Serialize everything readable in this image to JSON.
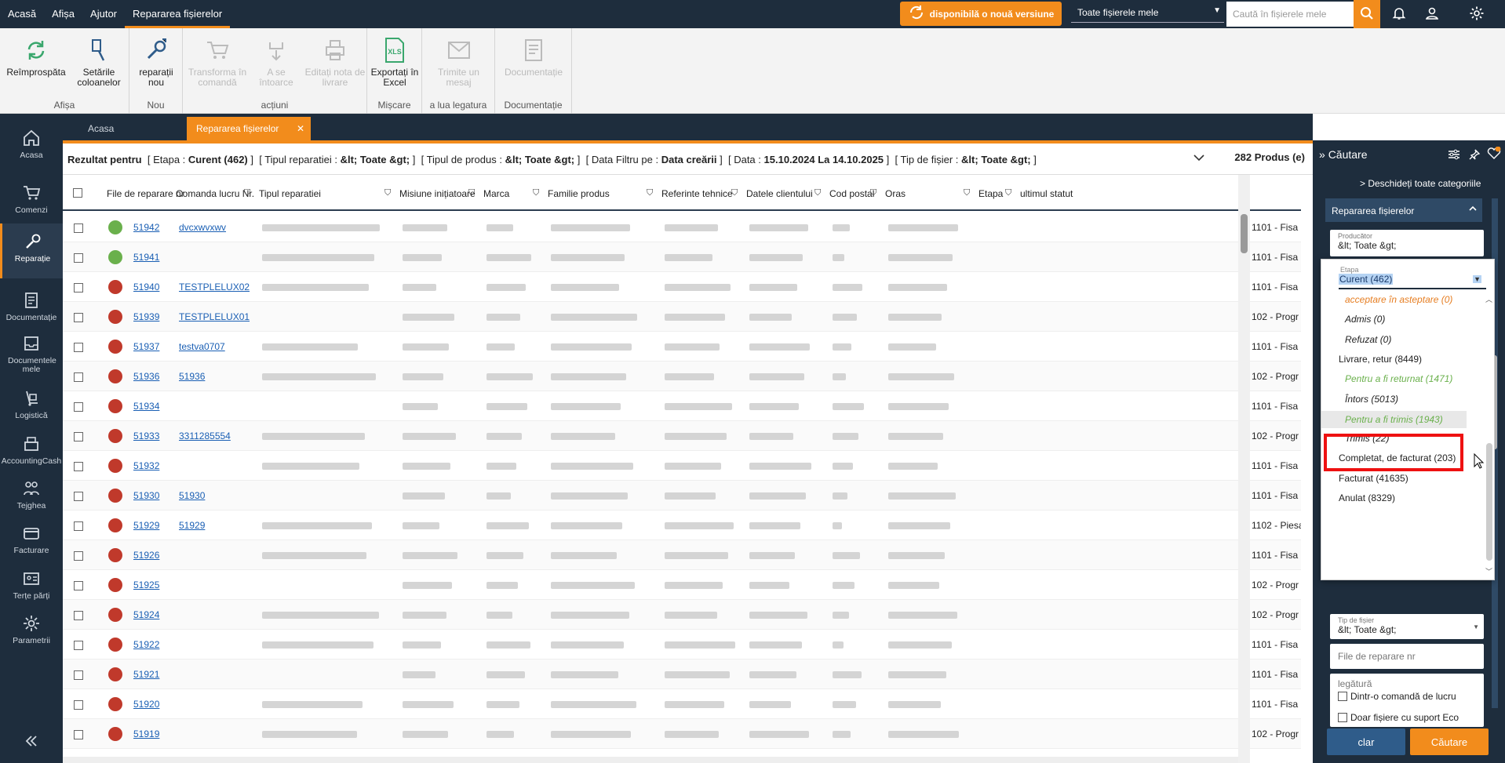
{
  "topbar": {
    "menu": [
      "Acasă",
      "Afișa",
      "Ajutor",
      "Repararea fișierelor"
    ],
    "new_version": "disponibilă o nouă versiune",
    "scope": "Toate fișierele mele",
    "search_placeholder": "Caută în fișierele mele",
    "notification_badge": "0"
  },
  "ribbon": {
    "groups": [
      {
        "label": "Afișa",
        "buttons": [
          "Reîmprospăta",
          "Setările coloanelor"
        ]
      },
      {
        "label": "Nou",
        "buttons": [
          "reparații nou"
        ]
      },
      {
        "label": "acțiuni",
        "buttons": [
          "Transforma în comandă",
          "A se întoarce",
          "Editați nota de livrare"
        ]
      },
      {
        "label": "Mișcare",
        "buttons": [
          "Exportați în Excel"
        ]
      },
      {
        "label": "a lua legatura",
        "buttons": [
          "Trimite un mesaj"
        ]
      },
      {
        "label": "Documentație",
        "buttons": [
          "Documentație"
        ]
      }
    ]
  },
  "nav": [
    "Acasa",
    "Comenzi",
    "Reparație",
    "Documentație",
    "Documentele mele",
    "Logistică",
    "AccountingCash",
    "Tejghea",
    "Facturare",
    "Terțe părți",
    "Parametrii"
  ],
  "tabs": [
    "Acasa",
    "Repararea fișierelor"
  ],
  "summary": {
    "prefix": "Rezultat pentru",
    "etapa_label": "Etapa :",
    "etapa_value": "Curent (462)",
    "tip_label": "Tipul reparatiei :",
    "tip_value": "&lt; Toate &gt;",
    "produs_label": "Tipul de produs :",
    "produs_value": "&lt; Toate &gt;",
    "filtru_label": "Data Filtru pe :",
    "filtru_value": "Data creării",
    "data_label": "Data :",
    "data_value": "15.10.2024 La 14.10.2025",
    "fisier_label": "Tip de fișier :",
    "fisier_value": "&lt; Toate &gt;",
    "count": "282 Produs (e)"
  },
  "columns": [
    "File de reparare nr",
    "Comanda lucru Nr.",
    "Tipul reparatiei",
    "Misiune inițiatoare",
    "Marca",
    "Familie produs",
    "Referinte tehnice",
    "Datele clientului",
    "Cod postal",
    "Oras",
    "Etapa",
    "ultimul statut"
  ],
  "rows": [
    {
      "nr": "51942",
      "cmd": "dvcxwvxwv",
      "status_color": "#6ab04c",
      "statut": "1101 - Fisa"
    },
    {
      "nr": "51941",
      "cmd": "",
      "status_color": "#6ab04c",
      "statut": "1101 - Fisa"
    },
    {
      "nr": "51940",
      "cmd": "TESTPLELUX02",
      "status_color": "#c0392b",
      "statut": "1101 - Fisa"
    },
    {
      "nr": "51939",
      "cmd": "TESTPLELUX01",
      "status_color": "#c0392b",
      "statut": "102 - Progr"
    },
    {
      "nr": "51937",
      "cmd": "testva0707",
      "status_color": "#c0392b",
      "statut": "1101 - Fisa"
    },
    {
      "nr": "51936",
      "cmd": "51936",
      "status_color": "#c0392b",
      "statut": "102 - Progr"
    },
    {
      "nr": "51934",
      "cmd": "",
      "status_color": "#c0392b",
      "statut": "1101 - Fisa"
    },
    {
      "nr": "51933",
      "cmd": "3311285554",
      "status_color": "#c0392b",
      "statut": "102 - Progr"
    },
    {
      "nr": "51932",
      "cmd": "",
      "status_color": "#c0392b",
      "statut": "1101 - Fisa"
    },
    {
      "nr": "51930",
      "cmd": "51930",
      "status_color": "#c0392b",
      "statut": "1101 - Fisa"
    },
    {
      "nr": "51929",
      "cmd": "51929",
      "status_color": "#c0392b",
      "statut": "1102 - Piesa"
    },
    {
      "nr": "51926",
      "cmd": "",
      "status_color": "#c0392b",
      "statut": "1101 - Fisa"
    },
    {
      "nr": "51925",
      "cmd": "",
      "status_color": "#c0392b",
      "statut": "102 - Progr"
    },
    {
      "nr": "51924",
      "cmd": "",
      "status_color": "#c0392b",
      "statut": "102 - Progr"
    },
    {
      "nr": "51922",
      "cmd": "",
      "status_color": "#c0392b",
      "statut": "1101 - Fisa"
    },
    {
      "nr": "51921",
      "cmd": "",
      "status_color": "#c0392b",
      "statut": "1101 - Fisa"
    },
    {
      "nr": "51920",
      "cmd": "",
      "status_color": "#c0392b",
      "statut": "1101 - Fisa"
    },
    {
      "nr": "51919",
      "cmd": "",
      "status_color": "#c0392b",
      "statut": "102 - Progr"
    }
  ],
  "panel": {
    "title": "Căutare",
    "open_all": "Deschideți toate categoriile",
    "section": "Repararea fișierelor",
    "producer_label": "Producător",
    "producer_value": "&lt; Toate &gt;",
    "file_type_label": "Tip de fișier",
    "file_type_value": "&lt; Toate &gt;",
    "file_nr_placeholder": "File de reparare nr",
    "link_label": "legătură",
    "from_order": "Dintr-o comandă de lucru",
    "eco_only": "Doar fișiere cu suport Eco",
    "clear": "clar",
    "search": "Căutare"
  },
  "dropdown": {
    "label": "Etapa",
    "selected": "Curent (462)",
    "options": [
      {
        "text": "acceptare în asteptare (0)",
        "color": "#e67e22",
        "italic": true
      },
      {
        "text": "Admis (0)",
        "color": "#222",
        "italic": true
      },
      {
        "text": "Refuzat (0)",
        "color": "#222",
        "italic": true
      },
      {
        "text": "Livrare, retur (8449)",
        "color": "#222",
        "italic": false
      },
      {
        "text": "Pentru a fi returnat (1471)",
        "color": "#6ab04c",
        "italic": true
      },
      {
        "text": "Întors (5013)",
        "color": "#222",
        "italic": true
      },
      {
        "text": "Pentru a fi trimis (1943)",
        "color": "#6ab04c",
        "italic": true
      },
      {
        "text": "Trimis (22)",
        "color": "#222",
        "italic": true
      },
      {
        "text": "Completat, de facturat (203)",
        "color": "#222",
        "italic": false
      },
      {
        "text": "Facturat (41635)",
        "color": "#222",
        "italic": false
      },
      {
        "text": "Anulat (8329)",
        "color": "#222",
        "italic": false
      }
    ]
  },
  "colors": {
    "accent": "#f28c1c",
    "navy": "#1e2d3d",
    "highlight": "#e11111"
  }
}
